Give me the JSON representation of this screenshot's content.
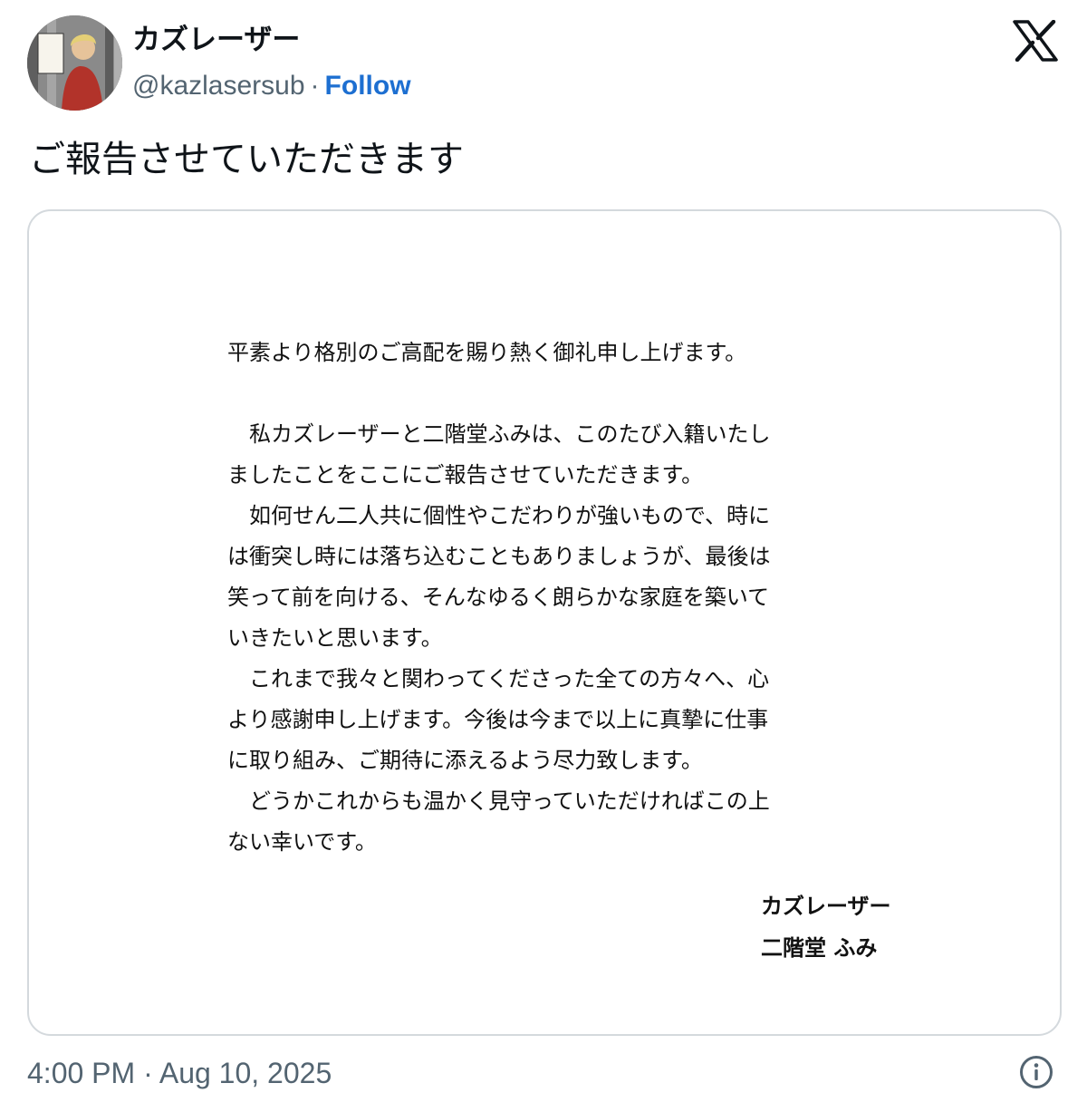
{
  "header": {
    "display_name": "カズレーザー",
    "handle": "@kazlasersub",
    "separator": "·",
    "follow_label": "Follow",
    "logo_icon": "x-logo-icon"
  },
  "avatar": {
    "sign_text": "和令"
  },
  "tweet": {
    "text": "ご報告させていただきます"
  },
  "letter": {
    "lines": [
      "平素より格別のご高配を賜り熱く御礼申し上げます。",
      "　私カズレーザーと二階堂ふみは、このたび入籍いたし",
      "ましたことをここにご報告させていただきます。",
      "　如何せん二人共に個性やこだわりが強いもので、時に",
      "は衝突し時には落ち込むこともありましょうが、最後は",
      "笑って前を向ける、そんなゆるく朗らかな家庭を築いて",
      "いきたいと思います。",
      "　これまで我々と関わってくださった全ての方々へ、心",
      "より感謝申し上げます。今後は今まで以上に真摯に仕事",
      "に取り組み、ご期待に添えるよう尽力致します。",
      "　どうかこれからも温かく見守っていただければこの上",
      "ない幸いです。"
    ],
    "signatures": [
      "カズレーザー",
      "二階堂 ふみ"
    ]
  },
  "footer": {
    "timestamp": "4:00 PM · Aug 10, 2025",
    "info_icon": "info-icon"
  },
  "colors": {
    "link": "#1d6fd1",
    "secondary_text": "#536471",
    "border": "#d4d9dd"
  }
}
